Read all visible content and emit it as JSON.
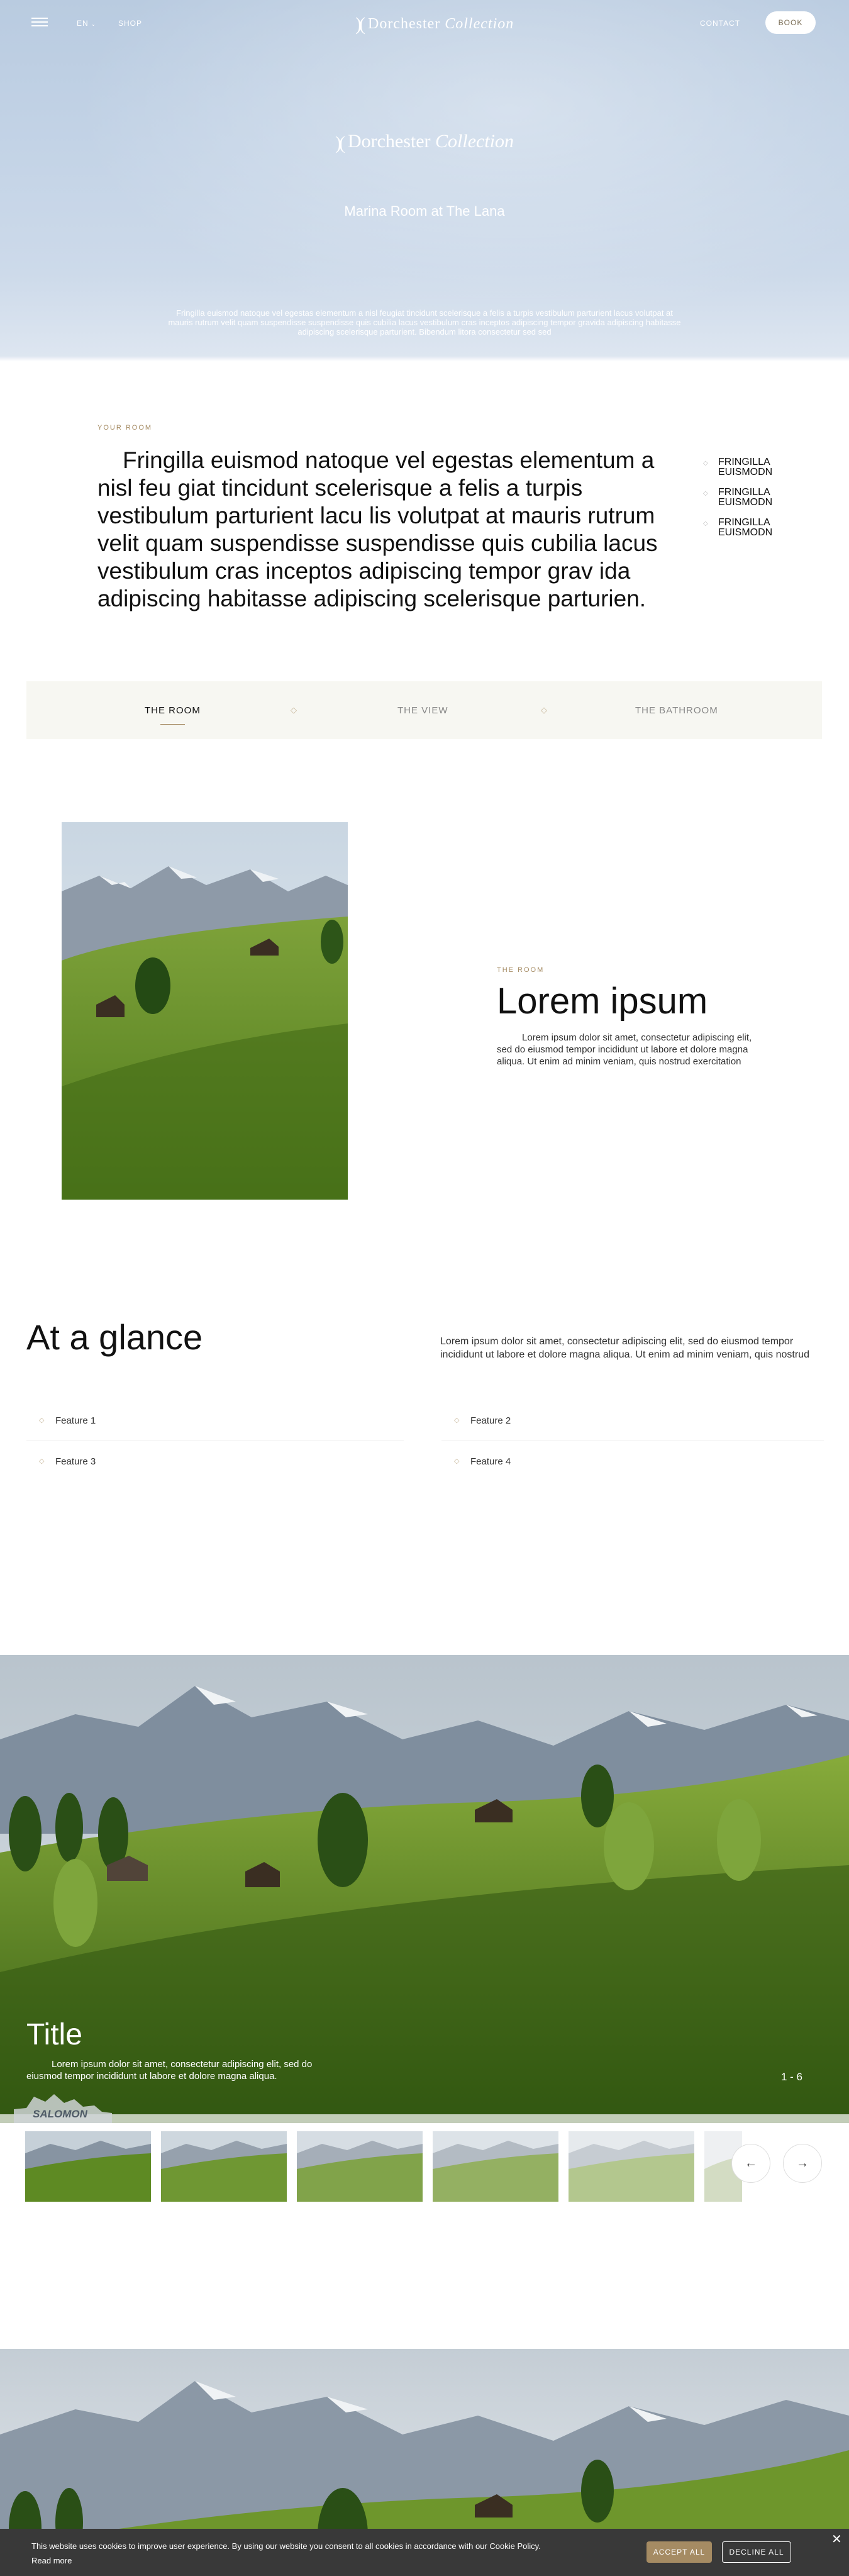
{
  "header": {
    "menu_icon": "hamburger-icon",
    "lang": "EN",
    "lang_icon": "chevron-down-icon",
    "shop": "SHOP",
    "logo_regular": "Dorchester",
    "logo_italic": "Collection",
    "contact": "CONTACT",
    "book": "BOOK"
  },
  "hero": {
    "logo_regular": "Dorchester",
    "logo_italic": "Collection",
    "subtitle": "Marina Room at The Lana",
    "body": "Fringilla euismod natoque vel egestas elementum a nisl feugiat tincidunt scelerisque a felis a turpis vestibulum parturient lacus volutpat at mauris rutrum velit quam suspendisse suspendisse quis cubilia lacus vestibulum cras inceptos adipiscing tempor gravida adipiscing habitasse adipiscing scelerisque parturient. Bibendum litora consectetur sed sed"
  },
  "your_room": {
    "eyebrow": "YOUR ROOM",
    "intro": "Fringilla euismod natoque vel egestas elementum a nisl feu giat tincidunt scelerisque a felis a turpis vestibulum parturient lacu lis volutpat at mauris rutrum velit quam suspendisse suspendisse quis cubilia lacus vestibulum cras inceptos adipiscing tempor grav ida adipiscing habitasse adipiscing scelerisque parturien.",
    "side_items": [
      "FRINGILLA EUISMODN",
      "FRINGILLA EUISMODN",
      "FRINGILLA EUISMODN"
    ]
  },
  "tabs": [
    {
      "label": "THE ROOM",
      "active": true
    },
    {
      "label": "THE VIEW",
      "active": false
    },
    {
      "label": "THE BATHROOM",
      "active": false
    }
  ],
  "room": {
    "eyebrow": "THE ROOM",
    "title": "Lorem ipsum",
    "body": "Lorem ipsum dolor sit amet, consectetur adipiscing elit, sed do eiusmod tempor incididunt ut labore et dolore magna aliqua. Ut enim ad minim veniam, quis nostrud exercitation"
  },
  "glance": {
    "title": "At a glance",
    "body": "Lorem ipsum dolor sit amet, consectetur adipiscing elit, sed do eiusmod tempor incididunt ut labore et dolore magna aliqua. Ut enim ad minim veniam, quis nostrud",
    "features": [
      "Feature 1",
      "Feature 2",
      "Feature 3",
      "Feature 4"
    ]
  },
  "slider": {
    "title": "Title",
    "body": "Lorem ipsum dolor sit amet, consectetur adipiscing elit, sed do eiusmod tempor incididunt ut labore et dolore magna aliqua.",
    "counter": "1 - 6",
    "brand": "SALOMON",
    "prev_icon": "arrow-left-icon",
    "next_icon": "arrow-right-icon"
  },
  "cookie": {
    "text": "This website uses cookies to improve user experience. By using our website you consent to all cookies in accordance with our Cookie Policy.",
    "read_more": "Read more",
    "accept": "ACCEPT ALL",
    "decline": "DECLINE ALL",
    "close": "✕"
  },
  "colors": {
    "accent": "#a58b63",
    "hero_sky": "#c3d3e6",
    "cookie_bg": "#393939"
  }
}
